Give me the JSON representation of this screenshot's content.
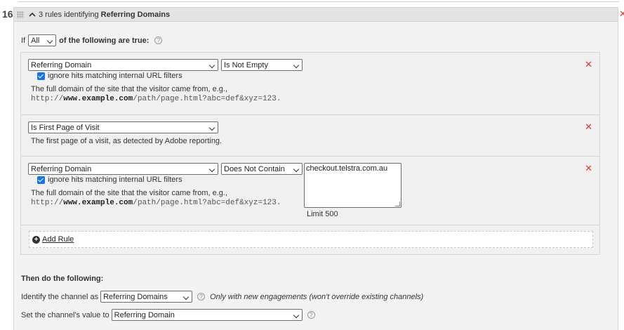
{
  "rule_number": "16",
  "header": {
    "count_text": "3 rules identifying",
    "type_text": "Referring Domains"
  },
  "condition": {
    "prefix": "If",
    "match": "All",
    "suffix": "of the following are true:"
  },
  "rules": [
    {
      "field": "Referring Domain",
      "operator": "Is Not Empty",
      "checkbox_label": "ignore hits matching internal URL filters",
      "desc": "The full domain of the site that the visitor came from, e.g.,",
      "code_pre": "http://",
      "code_bold": "www.example.com",
      "code_post": "/path/page.html?abc=def&xyz=123."
    },
    {
      "field": "Is First Page of Visit",
      "desc": "The first page of a visit, as detected by Adobe reporting."
    },
    {
      "field": "Referring Domain",
      "operator": "Does Not Contain",
      "checkbox_label": "ignore hits matching internal URL filters",
      "desc": "The full domain of the site that the visitor came from, e.g.,",
      "code_pre": "http://",
      "code_bold": "www.example.com",
      "code_post": "/path/page.html?abc=def&xyz=123.",
      "value": "checkout.telstra.com.au",
      "limit": "Limit 500"
    }
  ],
  "add_rule": "Add Rule",
  "then": {
    "heading": "Then do the following:",
    "channel_label": "Identify the channel as",
    "channel_value": "Referring Domains",
    "channel_note": "Only with new engagements (won't override existing channels)",
    "value_label": "Set the channel's value to",
    "value_value": "Referring Domain"
  },
  "icons": {
    "close": "close-x-icon",
    "help": "help-icon",
    "add": "add-circle-icon",
    "collapse": "chevron-up-icon",
    "drag": "drag-handle-icon"
  },
  "colors": {
    "remove": "#e6352d",
    "checkbox": "#1473e6"
  }
}
